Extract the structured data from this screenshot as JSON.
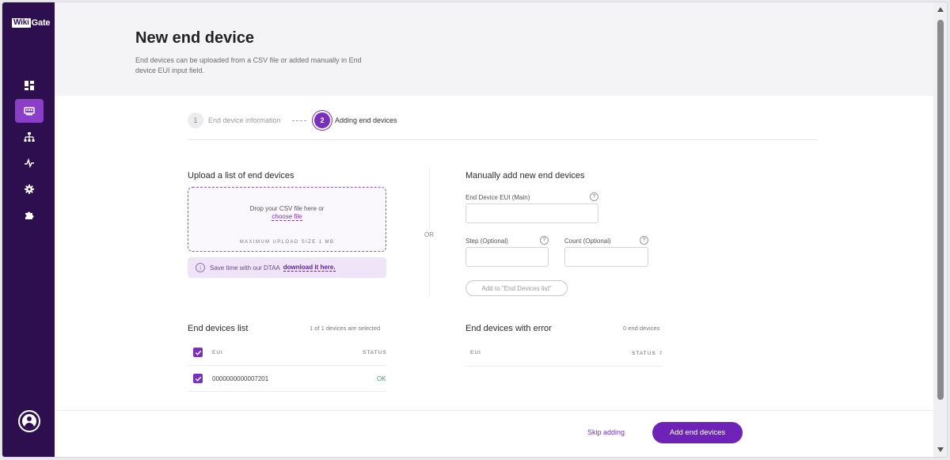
{
  "app": {
    "logo_box": "Wiki",
    "logo_text": "Gate"
  },
  "sidebar": {
    "items": [
      {
        "name": "dashboard",
        "icon": "dashboard-icon",
        "active": false
      },
      {
        "name": "end-devices",
        "icon": "device-icon",
        "active": true
      },
      {
        "name": "network",
        "icon": "network-icon",
        "active": false
      },
      {
        "name": "activity",
        "icon": "activity-icon",
        "active": false
      },
      {
        "name": "settings",
        "icon": "gear-icon",
        "active": false
      },
      {
        "name": "integrations",
        "icon": "puzzle-icon",
        "active": false
      }
    ]
  },
  "header": {
    "title": "New end device",
    "subtitle": "End devices can be uploaded from a CSV file or added manually in End device EUI input field."
  },
  "stepper": {
    "steps": [
      {
        "num": "1",
        "label": "End device information"
      },
      {
        "num": "2",
        "label": "Adding end devices"
      }
    ]
  },
  "upload": {
    "title": "Upload a list of end devices",
    "drop_text": "Drop your CSV file here or",
    "choose_file": "choose file",
    "max_size": "MAXIMUM UPLOAD SIZE 1 MB",
    "banner_text": "Save time with our DTAA",
    "banner_link": "download it here."
  },
  "divider": {
    "or": "OR"
  },
  "manual": {
    "title": "Manually add new end devices",
    "eui_label": "End Device EUI (Main)",
    "eui_value": "",
    "step_label": "Step (Optional)",
    "step_value": "",
    "count_label": "Count (Optional)",
    "count_value": "",
    "help": "?",
    "add_button": "Add to \"End Devices list\""
  },
  "devices_list": {
    "title": "End devices list",
    "count": "1 of 1 devices are selected",
    "columns": {
      "eui": "EUI",
      "status": "STATUS"
    },
    "rows": [
      {
        "eui": "0000000000007201",
        "status": "OK",
        "selected": true
      }
    ]
  },
  "errors_list": {
    "title": "End devices with error",
    "count": "0 end devices",
    "columns": {
      "eui": "EUI",
      "status": "STATUS"
    },
    "sort_icon": "⇕"
  },
  "footer": {
    "skip": "Skip adding",
    "add": "Add end devices"
  },
  "colors": {
    "sidebar": "#2d0f4f",
    "accent": "#7b2fc0",
    "active_nav": "#8a3fc6",
    "ok": "#2fa36b"
  }
}
